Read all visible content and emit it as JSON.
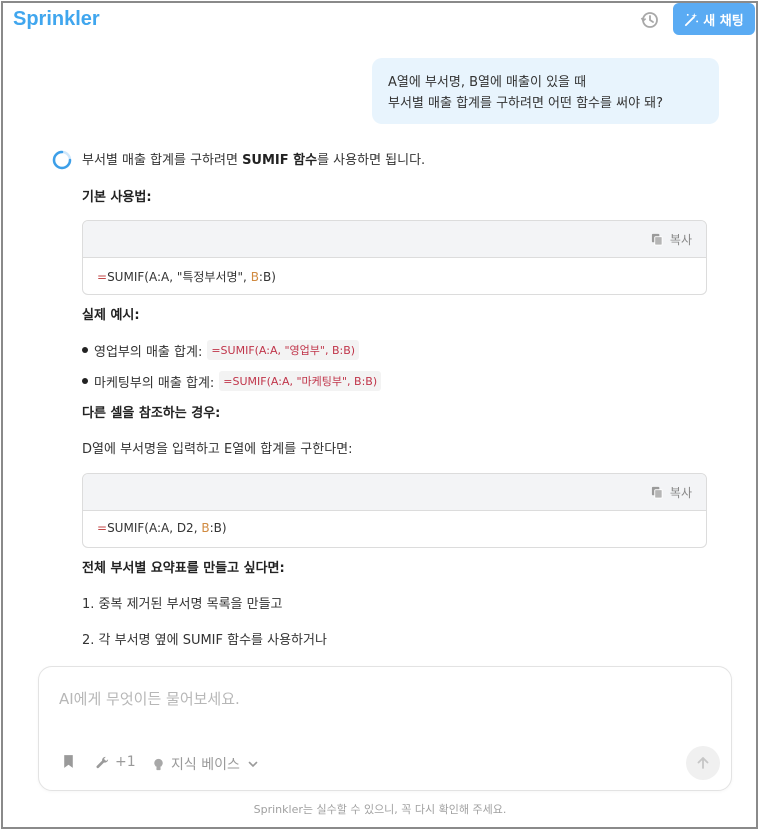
{
  "header": {
    "logo": "Sprinkler",
    "new_chat_label": "새 채팅"
  },
  "user_message": {
    "line1": "A열에 부서명, B열에 매출이 있을 때",
    "line2": "부서별 매출 합계를 구하려면 어떤 함수를 써야 돼?"
  },
  "answer": {
    "intro_pre": "부서별 매출 합계를 구하려면 ",
    "intro_bold": "SUMIF 함수",
    "intro_post": "를 사용하면 됩니다.",
    "h_basic": "기본 사용법:",
    "copy_label": "복사",
    "code1": {
      "eq": "=",
      "p1": "SUMIF(A:A, \"특정부서명\", ",
      "p2": "B",
      "p3": ":B)"
    },
    "h_example": "실제 예시:",
    "example1_label": "영업부의 매출 합계:",
    "example1_code": "=SUMIF(A:A, \"영업부\", B:B)",
    "example2_label": "마케팅부의 매출 합계:",
    "example2_code": "=SUMIF(A:A, \"마케팅부\", B:B)",
    "h_ref": "다른 셀을 참조하는 경우:",
    "ref_text": "D열에 부서명을 입력하고 E열에 합계를 구한다면:",
    "code2": {
      "eq": "=",
      "p1": "SUMIF(A:A, D2, ",
      "p2": "B",
      "p3": ":B)"
    },
    "h_summary": "전체 부서별 요약표를 만들고 싶다면:",
    "step1": "1. 중복 제거된 부서명 목록을 만들고",
    "step2": "2. 각 부서명 옆에 SUMIF 함수를 사용하거나"
  },
  "composer": {
    "placeholder": "AI에게 무엇이든 물어보세요.",
    "tools_label": "+1",
    "knowledge_label": "지식 베이스"
  },
  "footer": {
    "disclaimer": "Sprinkler는 실수할 수 있으니, 꼭 다시 확인해 주세요."
  },
  "colors": {
    "accent": "#5aabf3",
    "logo": "#40a6ee",
    "code_red": "#c0354a",
    "code_orange": "#d08a40"
  },
  "icons": [
    "history-icon",
    "magic-wand-icon",
    "loading-spinner-icon",
    "copy-icon",
    "bookmark-icon",
    "wrench-icon",
    "lightbulb-icon",
    "chevron-down-icon",
    "arrow-up-icon"
  ]
}
